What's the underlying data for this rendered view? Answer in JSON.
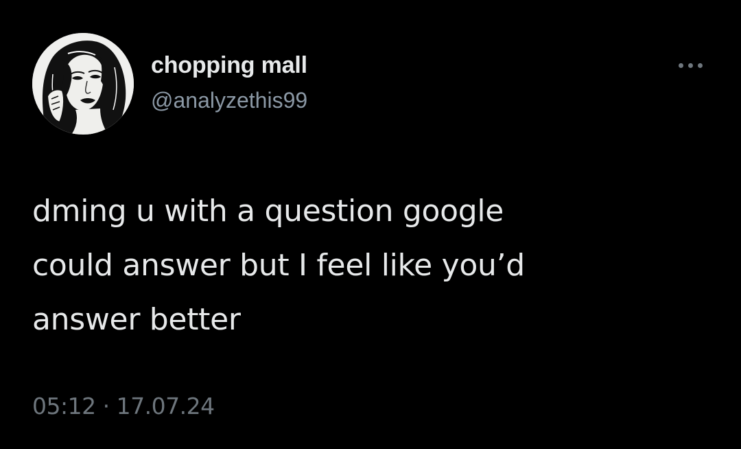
{
  "author": {
    "display_name": "chopping mall",
    "handle": "@analyzethis99",
    "avatar_icon": "profile-portrait-drawing"
  },
  "more_icon": "more-options-icon",
  "tweet": {
    "lines": [
      "dming u with a question google",
      "could answer but I feel like you’d",
      "answer better"
    ]
  },
  "meta": {
    "time": "05:12",
    "separator": "·",
    "date": "17.07.24"
  },
  "colors": {
    "background": "#000000",
    "primary_text": "#e7e9ea",
    "secondary_text": "#6e767d"
  }
}
